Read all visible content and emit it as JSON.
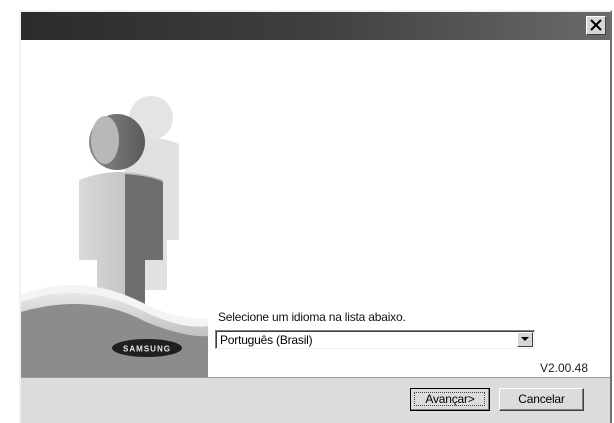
{
  "window": {
    "title": ""
  },
  "icons": {
    "close": "close-icon",
    "dropdown": "chevron-down-icon",
    "illustration": "people-illustration",
    "logo": "samsung-logo"
  },
  "branding": {
    "logo_text": "SAMSUNG"
  },
  "main": {
    "prompt": "Selecione um idioma na lista abaixo.",
    "language_select": {
      "selected": "Português (Brasil)"
    },
    "version": "V2.00.48"
  },
  "footer": {
    "next_label": "Avançar>",
    "cancel_label": "Cancelar"
  },
  "colors": {
    "title_bar_dark": "#2b2b2b",
    "panel_gray": "#dcdcdc",
    "illustration_dark": "#6e6e6e"
  }
}
